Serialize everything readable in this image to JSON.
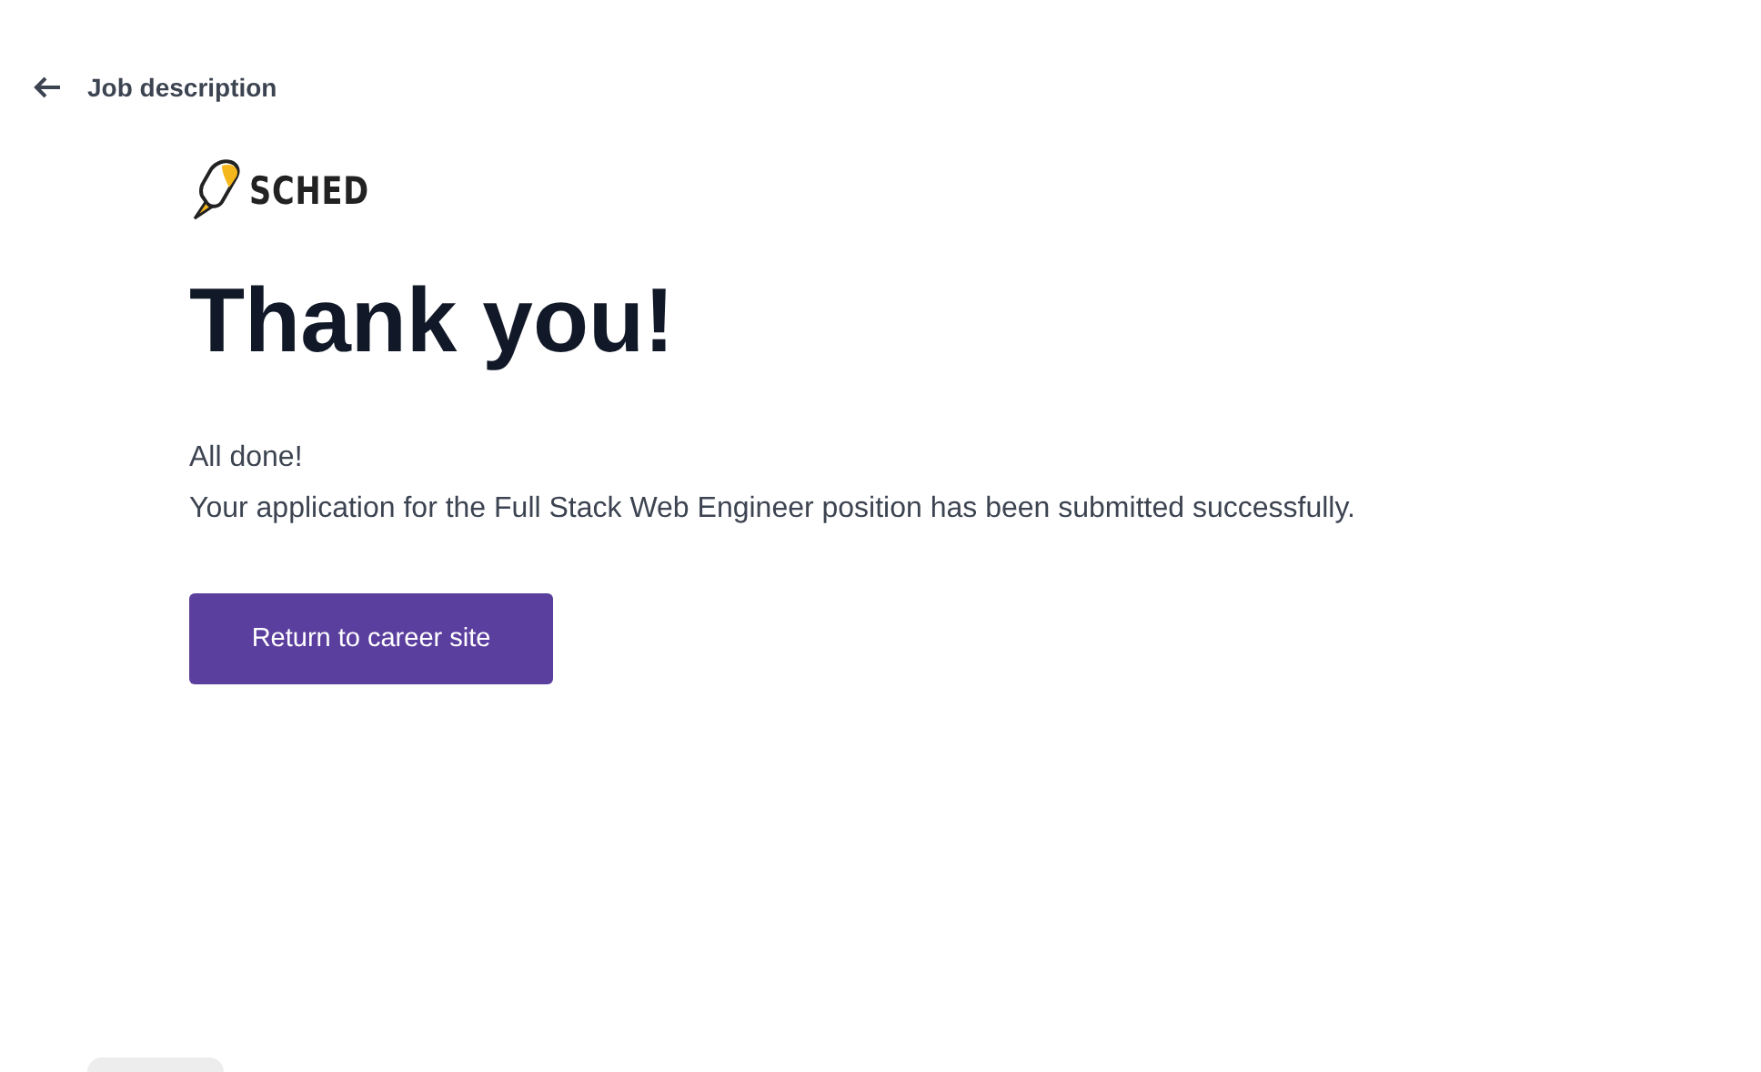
{
  "back_link": {
    "label": "Job description"
  },
  "logo": {
    "text": "SCHED"
  },
  "heading": "Thank you!",
  "messages": [
    "All done!",
    "Your application for the Full Stack Web Engineer position has been submitted successfully."
  ],
  "button": {
    "label": "Return to career site"
  }
}
